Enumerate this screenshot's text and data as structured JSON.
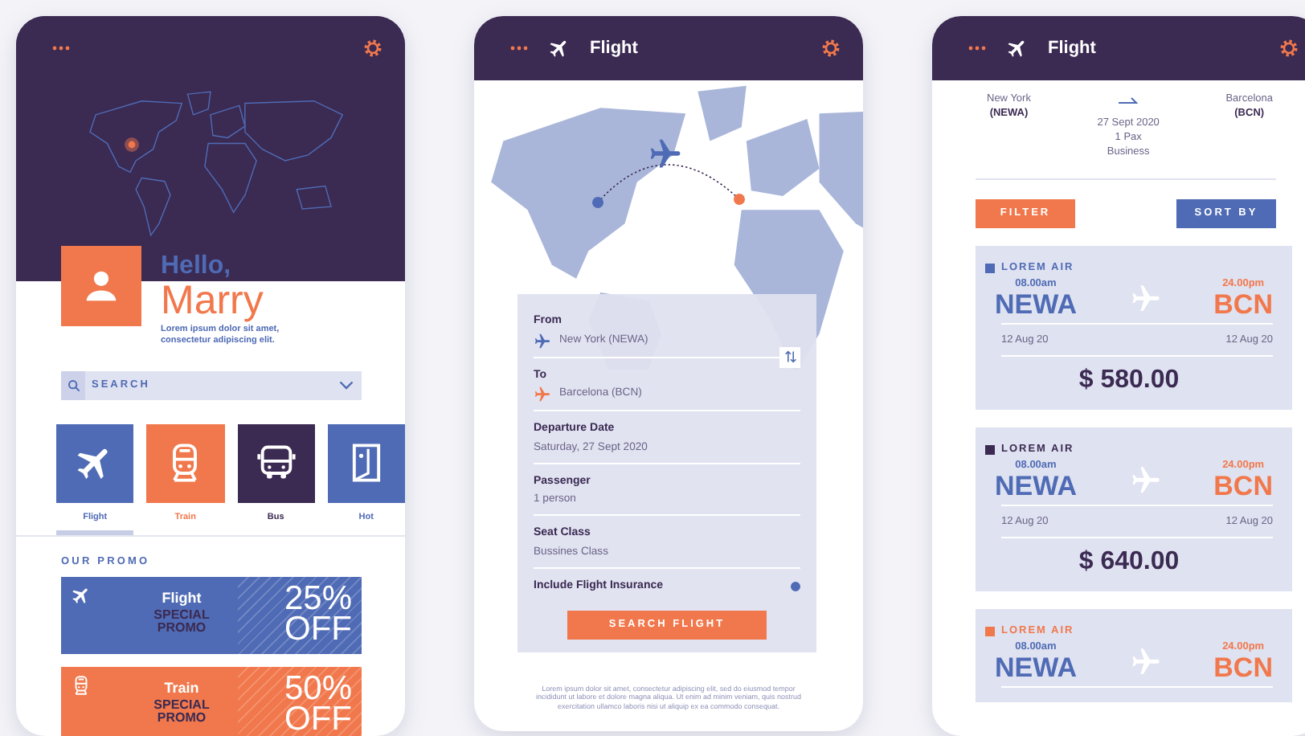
{
  "home_screen": {
    "greeting": "Hello,",
    "user_name": "Marry",
    "tagline": "Lorem ipsum dolor sit amet, consectetur adipiscing elit.",
    "search": {
      "placeholder": "SEARCH"
    },
    "categories": [
      {
        "kind": "flight",
        "label": "Flight",
        "color": "#4f6bb5",
        "selected": true
      },
      {
        "kind": "train",
        "label": "Train",
        "color": "#f1784c",
        "selected": false
      },
      {
        "kind": "bus",
        "label": "Bus",
        "color": "#3b2a52",
        "selected": false
      },
      {
        "kind": "hotel",
        "label": "Hot",
        "color": "#4f6bb5",
        "selected": false
      }
    ],
    "promo_heading": "OUR PROMO",
    "promos": [
      {
        "kind": "flight",
        "title": "Flight",
        "subtitle": "SPECIAL PROMO",
        "discount": "25%",
        "off": "OFF",
        "color": "#4f6bb5"
      },
      {
        "kind": "train",
        "title": "Train",
        "subtitle": "SPECIAL PROMO",
        "discount": "50%",
        "off": "OFF",
        "color": "#f1784c"
      }
    ]
  },
  "flight_search_screen": {
    "title": "Flight",
    "fields": [
      {
        "kind": "origin",
        "label": "From",
        "value": "New York (NEWA)"
      },
      {
        "kind": "destination",
        "label": "To",
        "value": "Barcelona (BCN)"
      },
      {
        "kind": "plain",
        "label": "Departure Date",
        "value": "Saturday, 27 Sept 2020"
      },
      {
        "kind": "plain",
        "label": "Passenger",
        "value": "1 person"
      },
      {
        "kind": "plain",
        "label": "Seat Class",
        "value": "Bussines Class"
      }
    ],
    "insurance": {
      "label": "Include Flight Insurance",
      "checked": true
    },
    "search_button": "SEARCH FLIGHT",
    "footnote": "Lorem ipsum dolor sit amet, consectetur adipiscing elit, sed do eiusmod tempor incididunt ut labore et dolore magna aliqua. Ut enim ad minim veniam, quis nostrud exercitation ullamco laboris nisi ut aliquip ex ea commodo consequat."
  },
  "flight_results_screen": {
    "title": "Flight",
    "summary": {
      "origin_city": "New York",
      "origin_code": "(NEWA)",
      "destination_city": "Barcelona",
      "destination_code": "(BCN)",
      "date": "27 Sept 2020",
      "passengers": "1 Pax",
      "cabin": "Business"
    },
    "filter_button": "FILTER",
    "sort_button": "SORT BY",
    "flights": [
      {
        "airline": "LOREM AIR",
        "color": "#4f6bb5",
        "depart_time": "08.00am",
        "from": "NEWA",
        "arrive_time": "24.00pm",
        "to": "BCN",
        "depart_date": "12 Aug 20",
        "arrive_date": "12 Aug 20",
        "price": "$ 580.00"
      },
      {
        "airline": "LOREM AIR",
        "color": "#3b2a52",
        "depart_time": "08.00am",
        "from": "NEWA",
        "arrive_time": "24.00pm",
        "to": "BCN",
        "depart_date": "12 Aug 20",
        "arrive_date": "12 Aug 20",
        "price": "$ 640.00"
      },
      {
        "airline": "LOREM AIR",
        "color": "#f1784c",
        "depart_time": "08.00am",
        "from": "NEWA",
        "arrive_time": "24.00pm",
        "to": "BCN"
      }
    ]
  }
}
